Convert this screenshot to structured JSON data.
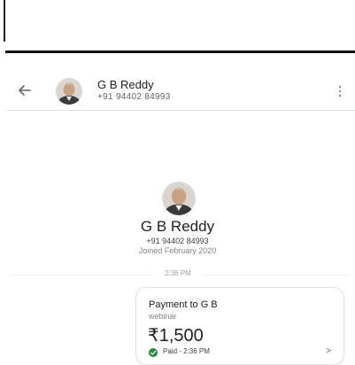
{
  "contact": {
    "name": "G B Reddy",
    "phone": "+91 94402 84993",
    "joined": "Joined February 2020"
  },
  "icons": {
    "back": "arrow-back-icon",
    "more": "more-vert-icon",
    "status": "check-circle-icon",
    "chevron": "chevron-right-icon"
  },
  "chat": {
    "time_divider": "2:36 PM"
  },
  "payment": {
    "title": "Payment to G B",
    "note": "webinar",
    "amount": "₹1,500",
    "status": "Paid - 2:36 PM",
    "status_color": "#1e8e3e"
  }
}
